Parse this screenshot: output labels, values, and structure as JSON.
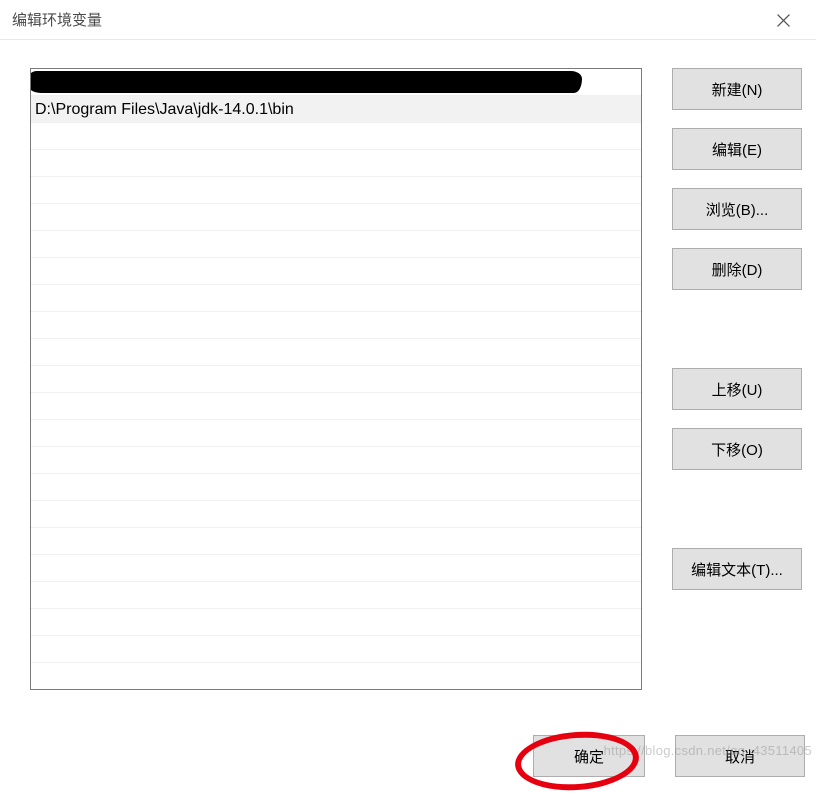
{
  "window": {
    "title": "编辑环境变量"
  },
  "list": {
    "rows": [
      {
        "value": "",
        "redacted": true
      },
      {
        "value": "D:\\Program Files\\Java\\jdk-14.0.1\\bin",
        "selected": true
      }
    ],
    "blank_count": 21
  },
  "buttons": {
    "new": "新建(N)",
    "edit": "编辑(E)",
    "browse": "浏览(B)...",
    "delete": "删除(D)",
    "move_up": "上移(U)",
    "move_down": "下移(O)",
    "edit_text": "编辑文本(T)...",
    "ok": "确定",
    "cancel": "取消"
  },
  "watermark": "https://blog.csdn.net/qq_43511405"
}
